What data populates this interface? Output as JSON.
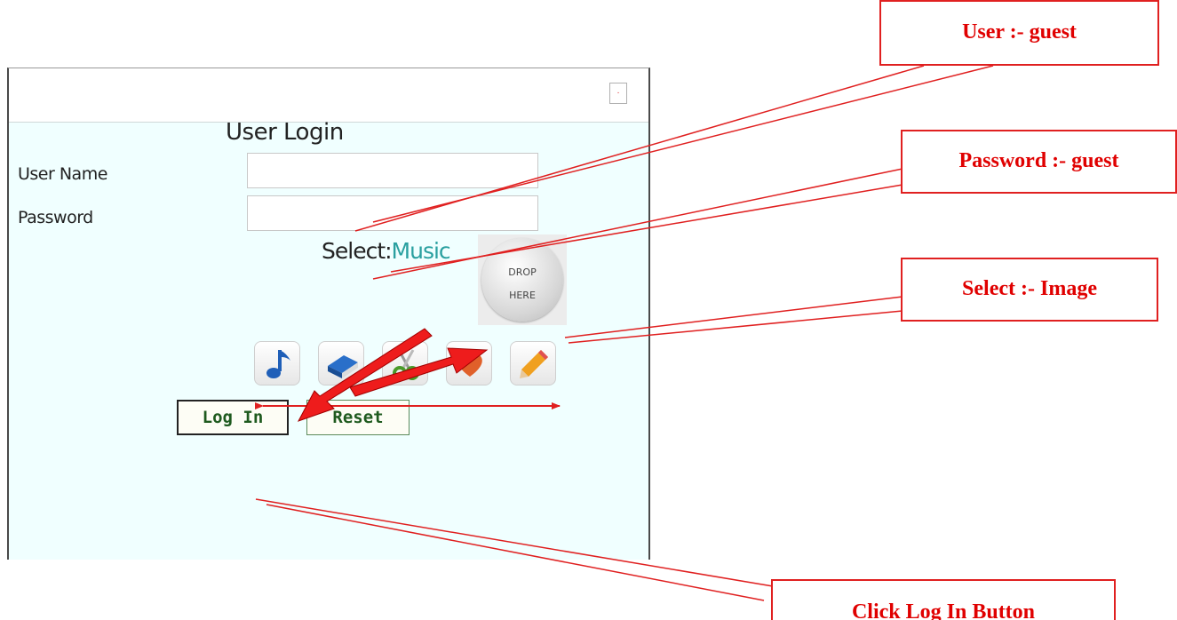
{
  "login": {
    "close_glyph": "·",
    "title": "User Login",
    "username_label": "User Name",
    "username_value": "",
    "password_label": "Password",
    "password_value": "",
    "select_prefix": "Select:",
    "select_value": "Music",
    "drop_zone": {
      "line1": "DROP",
      "line2": "HERE"
    },
    "icons": [
      {
        "name": "music-note-icon"
      },
      {
        "name": "book-icon"
      },
      {
        "name": "scissors-icon"
      },
      {
        "name": "heart-icon"
      },
      {
        "name": "pencil-icon"
      }
    ],
    "login_button": "Log In",
    "reset_button": "Reset"
  },
  "annotations": {
    "user": "User :- guest",
    "password": "Password :- guest",
    "select": "Select :- Image",
    "login": "Click Log In Button"
  },
  "colors": {
    "accent": "#e00000",
    "panel_bg": "#f0ffff",
    "button_text": "#1e5a1e",
    "select_value": "#2aa0a0"
  }
}
